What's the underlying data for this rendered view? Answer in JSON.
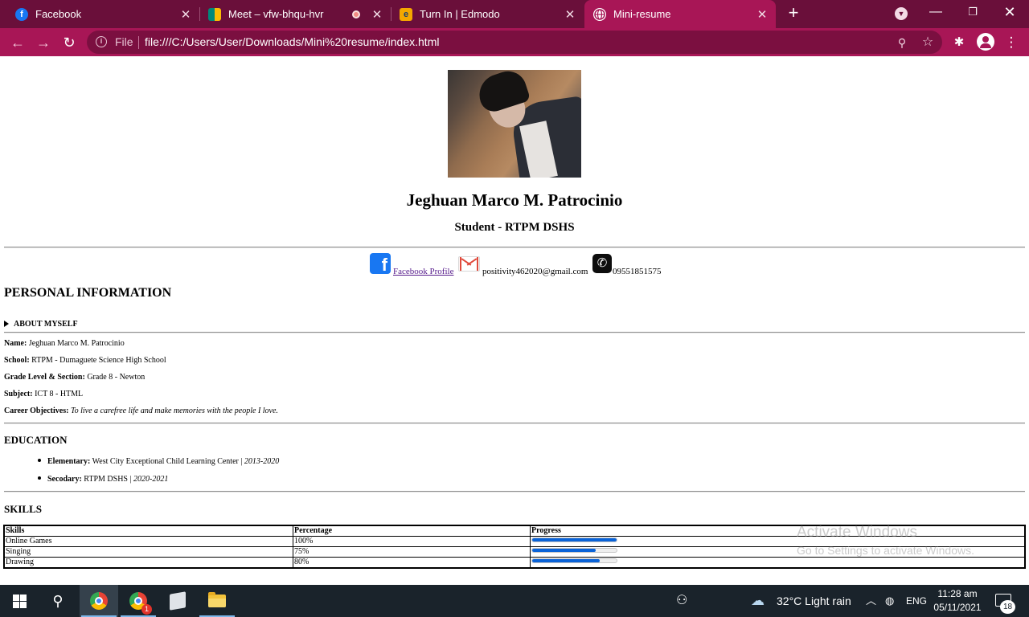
{
  "browser": {
    "tabs": [
      {
        "title": "Facebook",
        "icon": "facebook-icon",
        "favicon_color": "#1877f2",
        "favicon_text": "f"
      },
      {
        "title": "Meet – vfw-bhqu-hvr",
        "icon": "google-meet-icon",
        "favicon_color": "#00897b",
        "favicon_text": ""
      },
      {
        "title": "Turn In | Edmodo",
        "icon": "edmodo-icon",
        "favicon_color": "#f5a800",
        "favicon_text": "e"
      },
      {
        "title": "Mini-resume",
        "icon": "globe-icon",
        "favicon_color": "#ffffff",
        "favicon_text": ""
      }
    ],
    "address": {
      "scheme_label": "File",
      "url": "file:///C:/Users/User/Downloads/Mini%20resume/index.html"
    },
    "theme": {
      "frame": "#6a0f3a",
      "toolbar": "#a81656"
    }
  },
  "resume": {
    "name": "Jeghuan Marco M. Patrocinio",
    "role": "Student - RTPM DSHS",
    "contact": {
      "facebook_label": "Facebook Profile",
      "email": "positivity462020@gmail.com",
      "phone": "09551851575"
    },
    "personal": {
      "heading": "PERSONAL INFORMATION",
      "summary": "ABOUT MYSELF",
      "fields": [
        {
          "label": "Name:",
          "value": " Jeghuan Marco M. Patrocinio"
        },
        {
          "label": "School:",
          "value": " RTPM - Dumaguete Science High School"
        },
        {
          "label": "Grade Level & Section:",
          "value": " Grade 8 - Newton"
        },
        {
          "label": "Subject:",
          "value": " ICT 8 - HTML"
        },
        {
          "label": "Career Objectives:",
          "value": " To live a carefree life and make memories with the people I love."
        }
      ]
    },
    "education": {
      "heading": "EDUCATION",
      "items": [
        {
          "label": "Elementary:",
          "school": " West City Exceptional Child Learning Center | ",
          "years": "2013-2020"
        },
        {
          "label": "Secodary:",
          "school": " RTPM DSHS | ",
          "years": "2020-2021"
        }
      ]
    },
    "skills": {
      "heading": "SKILLS",
      "columns": [
        "Skills",
        "Percentage",
        "Progress"
      ],
      "rows": [
        {
          "skill": "Online Games",
          "percent_label": "100%",
          "progress": 1.0
        },
        {
          "skill": "Singing",
          "percent_label": "75%",
          "progress": 0.75
        },
        {
          "skill": "Drawing",
          "percent_label": "80%",
          "progress": 0.8
        }
      ]
    }
  },
  "watermark": {
    "line1": "Activate Windows",
    "line2": "Go to Settings to activate Windows."
  },
  "taskbar": {
    "weather": "32°C  Light rain",
    "language": "ENG",
    "time": "11:28 am",
    "date": "05/11/2021",
    "notification_count": "18",
    "meet_badge": "1"
  }
}
